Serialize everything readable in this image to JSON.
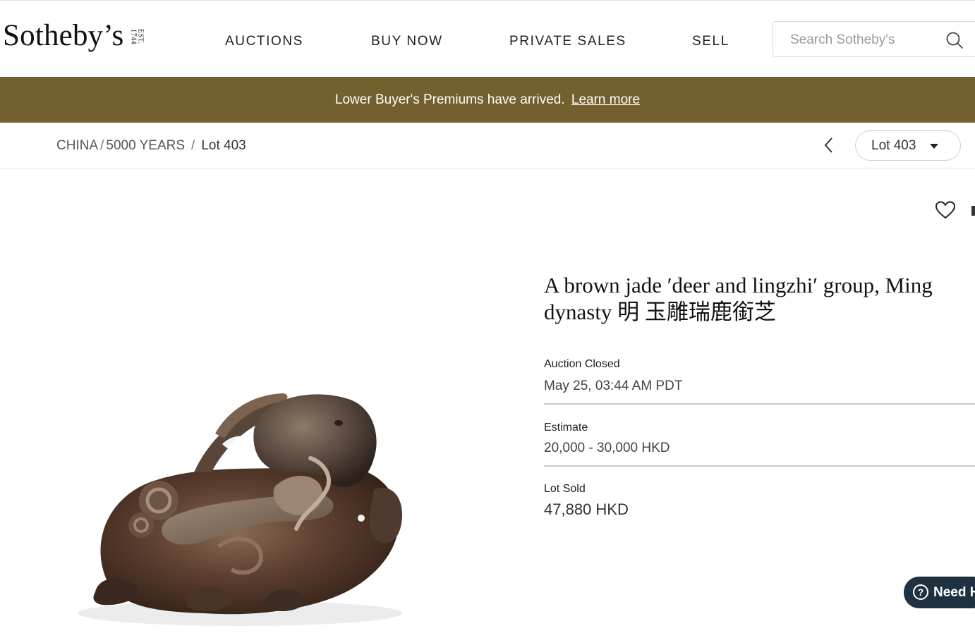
{
  "header": {
    "logo_text": "Sotheby’s",
    "logo_est": "EST. 1744",
    "nav": [
      "AUCTIONS",
      "BUY NOW",
      "PRIVATE SALES",
      "SELL"
    ],
    "search_placeholder": "Search Sotheby's"
  },
  "banner": {
    "text": "Lower Buyer's Premiums have arrived.",
    "link": "Learn more"
  },
  "breadcrumb": {
    "items": [
      "CHINA",
      "5000 YEARS",
      "Lot 403"
    ],
    "lot_select": "Lot 403"
  },
  "lot": {
    "title": "A brown jade ′deer and lingzhi′ group, Ming dynasty 明 玉雕瑞鹿銜芝",
    "status_label": "Auction Closed",
    "status_value": "May 25, 03:44 AM PDT",
    "estimate_label": "Estimate",
    "estimate_value": "20,000 - 30,000 HKD",
    "sold_label": "Lot Sold",
    "sold_value": "47,880 HKD"
  },
  "help": {
    "label": "Need H"
  },
  "icons": {
    "search": "search-icon",
    "prev": "chevron-left-icon",
    "caret": "caret-down-icon",
    "favorite": "heart-icon",
    "help": "help-icon"
  },
  "colors": {
    "banner": "#74602e",
    "help_button": "#1f3140"
  }
}
